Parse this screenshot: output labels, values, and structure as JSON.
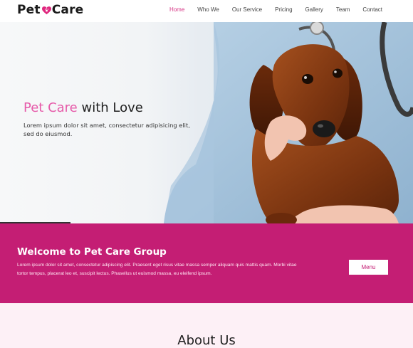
{
  "brand": {
    "name_part1": "Pet",
    "name_part2": "Care",
    "accent_color": "#e0287f"
  },
  "nav": {
    "items": [
      {
        "label": "Home",
        "active": true
      },
      {
        "label": "Who We",
        "active": false
      },
      {
        "label": "Our Service",
        "active": false
      },
      {
        "label": "Pricing",
        "active": false
      },
      {
        "label": "Gallery",
        "active": false
      },
      {
        "label": "Team",
        "active": false
      },
      {
        "label": "Contact",
        "active": false
      }
    ]
  },
  "hero": {
    "title_accent": "Pet Care",
    "title_rest": " with Love",
    "description": "Lorem ipsum dolor sit amet, consectetur adipisicing elit, sed do eiusmod.",
    "image_subject": "dachshund-with-veterinarian",
    "slider_progress": 0.17
  },
  "welcome": {
    "title": "Welcome to Pet Care Group",
    "text": "Lorem ipsum dolor sit amet, consectetur adipiscing elit. Praesent eget risus vitae massa semper aliquam quis mattis quam. Morbi vitae tortor tempus, placerat leo et, suscipit lectus. Phasellus ut euismod massa, eu eleifend ipsum.",
    "button_label": "Menu",
    "bg_color": "#c41e74"
  },
  "about": {
    "title": "About Us",
    "bg_color": "#fdf0f6"
  }
}
